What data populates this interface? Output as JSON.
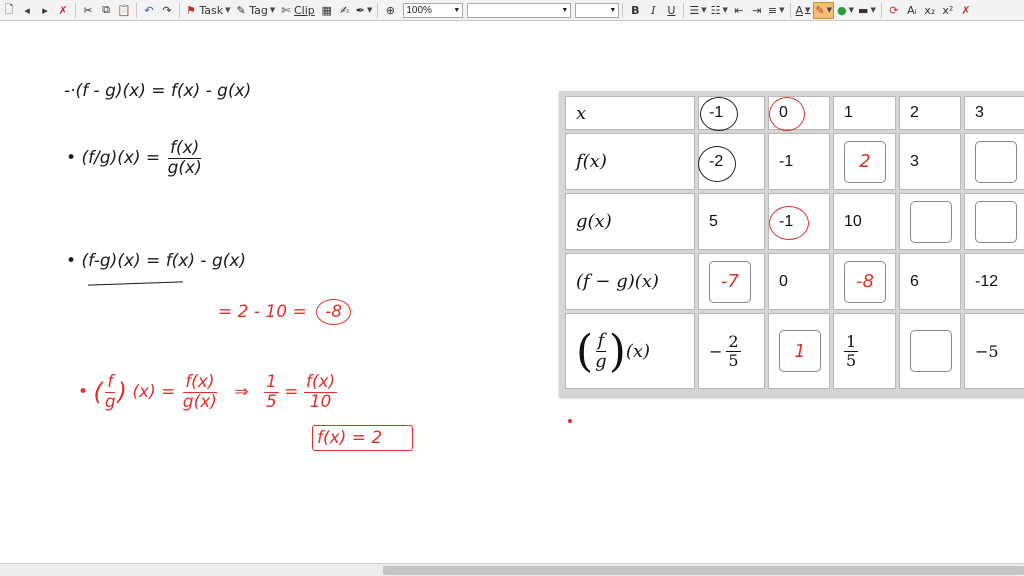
{
  "toolbar": {
    "task_label": "Task",
    "tag_label": "Tag",
    "clip_label": "Clip",
    "zoom_value": "100%",
    "bold": "B",
    "italic": "I",
    "underline": "U",
    "font_size_letter": "A"
  },
  "notes": {
    "line1": "-·(f - g)(x) = f(x) - g(x)",
    "line2_lhs": "(f/g)(x) =",
    "line2_num": "f(x)",
    "line2_den": "g(x)",
    "line3": "(f-g)(x) = f(x) - g(x)",
    "line4": "= 2 - 10 =",
    "line4_result": "-8",
    "line5_f": "f",
    "line5_g": "g",
    "line5_mid": "(x) =",
    "line5_num": "f(x)",
    "line5_den": "g(x)",
    "line5_arrow": "⇒",
    "line5_num2": "1",
    "line5_den2": "5",
    "line5_eq": "=",
    "line5_num3": "f(x)",
    "line5_den3": "10",
    "boxed_result": "f(x) = 2"
  },
  "table": {
    "header_row": [
      "x",
      "-1",
      "0",
      "1",
      "2",
      "3"
    ],
    "row_headers": [
      "f(x)",
      "g(x)",
      "(f − g)(x)"
    ],
    "fg_row_label_f": "f",
    "fg_row_label_g": "g",
    "fg_row_label_x": "(x)",
    "f_values": [
      "-2",
      "-1",
      "2",
      "3",
      ""
    ],
    "g_values": [
      "5",
      "-1",
      "10",
      "",
      ""
    ],
    "fminusg_values": [
      "-7",
      "0",
      "-8",
      "6",
      "-12"
    ],
    "fdivg_neg1_sign": "−",
    "fdivg_neg1_num": "2",
    "fdivg_neg1_den": "5",
    "fdivg_0": "1",
    "fdivg_1_num": "1",
    "fdivg_1_den": "5",
    "fdivg_3": "−5"
  },
  "colors": {
    "ink_black": "#1a1a1a",
    "ink_red": "#e0302a"
  }
}
